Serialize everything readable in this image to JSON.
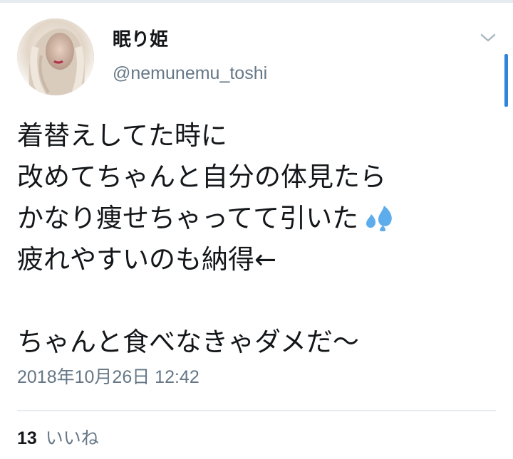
{
  "user": {
    "display_name": "眠り姫",
    "handle": "@nemunemu_toshi"
  },
  "tweet": {
    "lines": [
      "着替えしてた時に",
      "改めてちゃんと自分の体見たら",
      "かなり痩せちゃってて引いた",
      "疲れやすいのも納得←",
      "",
      "ちゃんと食べなきゃダメだ〜"
    ],
    "emoji": "sweat-droplets-icon",
    "timestamp": "2018年10月26日 12:42"
  },
  "stats": {
    "likes_count": "13",
    "likes_label": "いいね"
  },
  "colors": {
    "text": "#14171a",
    "secondary": "#657786",
    "accent": "#2d86d9",
    "divider": "#e6ecf0"
  }
}
